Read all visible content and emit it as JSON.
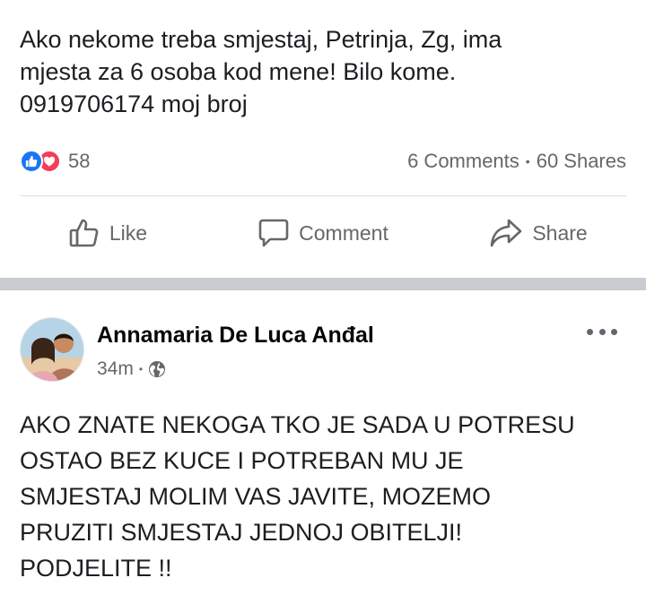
{
  "post1": {
    "text": "Ako nekome treba smjestaj, Petrinja, Zg, ima\nmjesta za 6 osoba kod mene! Bilo kome.\n0919706174 moj broj",
    "reactions_count": "58",
    "comments": "6 Comments",
    "shares": "60 Shares",
    "separator": "•",
    "reaction_icons": [
      "like-icon",
      "love-icon"
    ],
    "colors": {
      "like": "#1877f2",
      "love": "#f33e58",
      "muted": "#65676b"
    }
  },
  "actions": {
    "like": "Like",
    "comment": "Comment",
    "share": "Share"
  },
  "post2": {
    "author": "Annamaria De Luca Anđal",
    "time": "34m",
    "separator": "•",
    "privacy_icon": "globe-icon",
    "text": "AKO ZNATE NEKOGA TKO JE SADA U POTRESU\nOSTAO BEZ KUCE I POTREBAN MU JE\nSMJESTAJ MOLIM VAS JAVITE, MOZEMO\nPRUZITI SMJESTAJ JEDNOJ OBITELJI!\nPODJELITE !!"
  }
}
